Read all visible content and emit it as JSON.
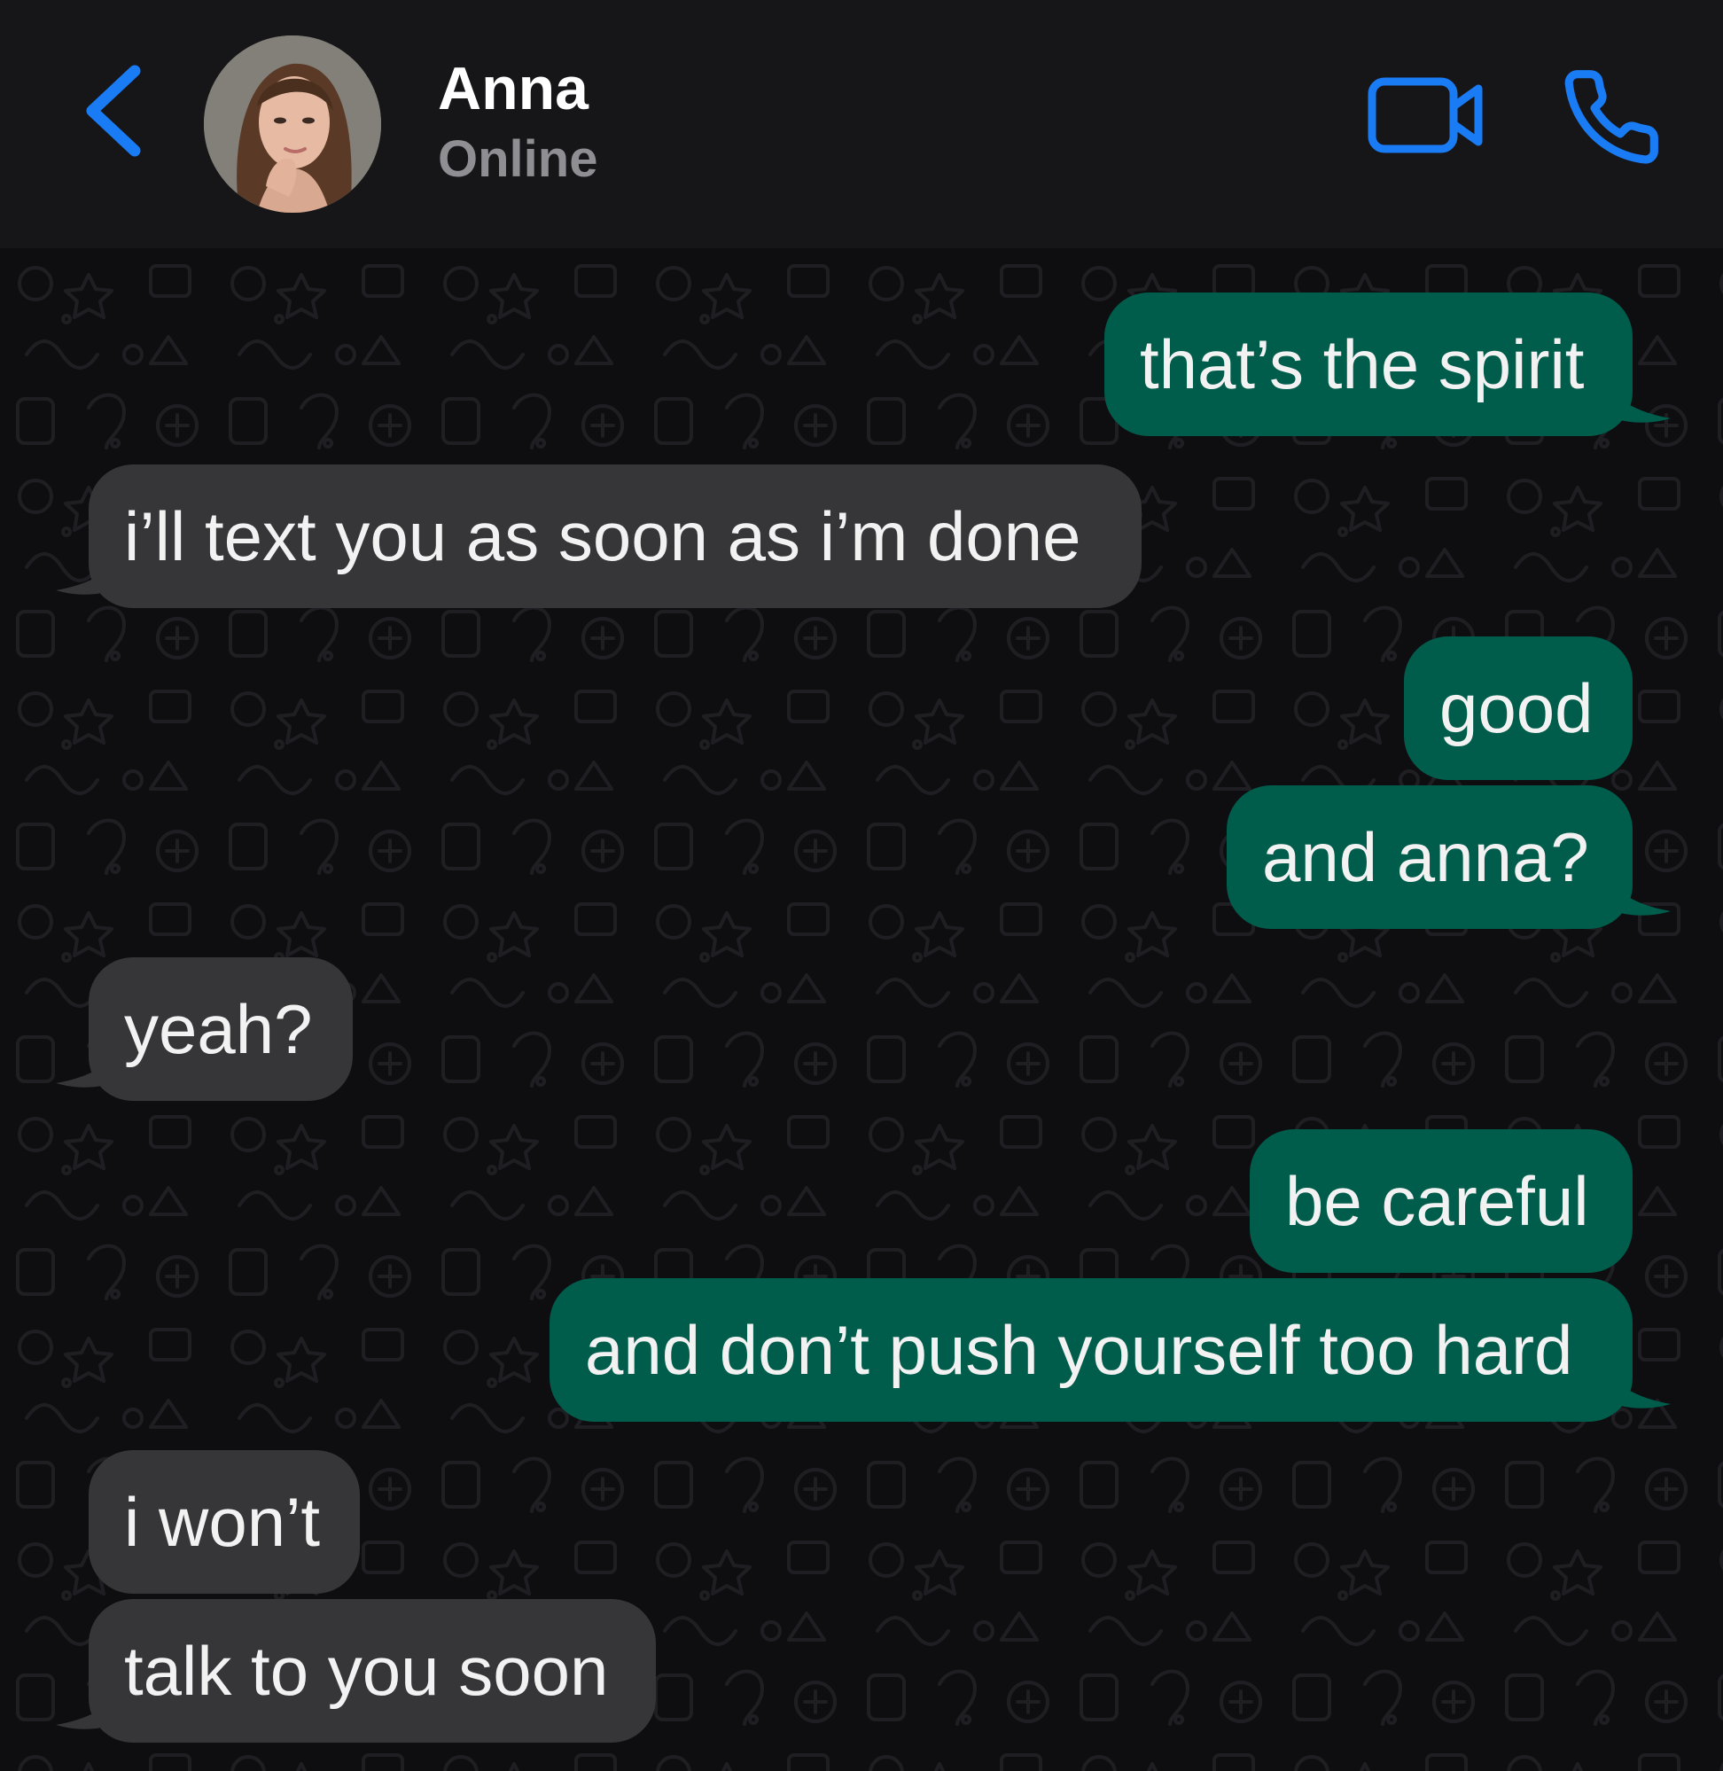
{
  "header": {
    "contact_name": "Anna",
    "contact_status": "Online",
    "accent_color": "#1a7cf5",
    "back_icon": "chevron-left-icon",
    "video_icon": "video-camera-icon",
    "call_icon": "phone-icon"
  },
  "colors": {
    "header_bg": "#161618",
    "chat_bg": "#0e0e11",
    "outgoing_bubble": "#005c4b",
    "incoming_bubble": "#363638",
    "status_text": "#8e8e93"
  },
  "messages": [
    {
      "direction": "outgoing",
      "text": "that’s the spirit"
    },
    {
      "direction": "incoming",
      "text": "i’ll text you as soon as i’m done"
    },
    {
      "direction": "outgoing",
      "text": "good"
    },
    {
      "direction": "outgoing",
      "text": "and anna?"
    },
    {
      "direction": "incoming",
      "text": "yeah?"
    },
    {
      "direction": "outgoing",
      "text": "be careful"
    },
    {
      "direction": "outgoing",
      "text": "and don’t push yourself too hard"
    },
    {
      "direction": "incoming",
      "text": "i won’t"
    },
    {
      "direction": "incoming",
      "text": "talk to you soon"
    }
  ]
}
